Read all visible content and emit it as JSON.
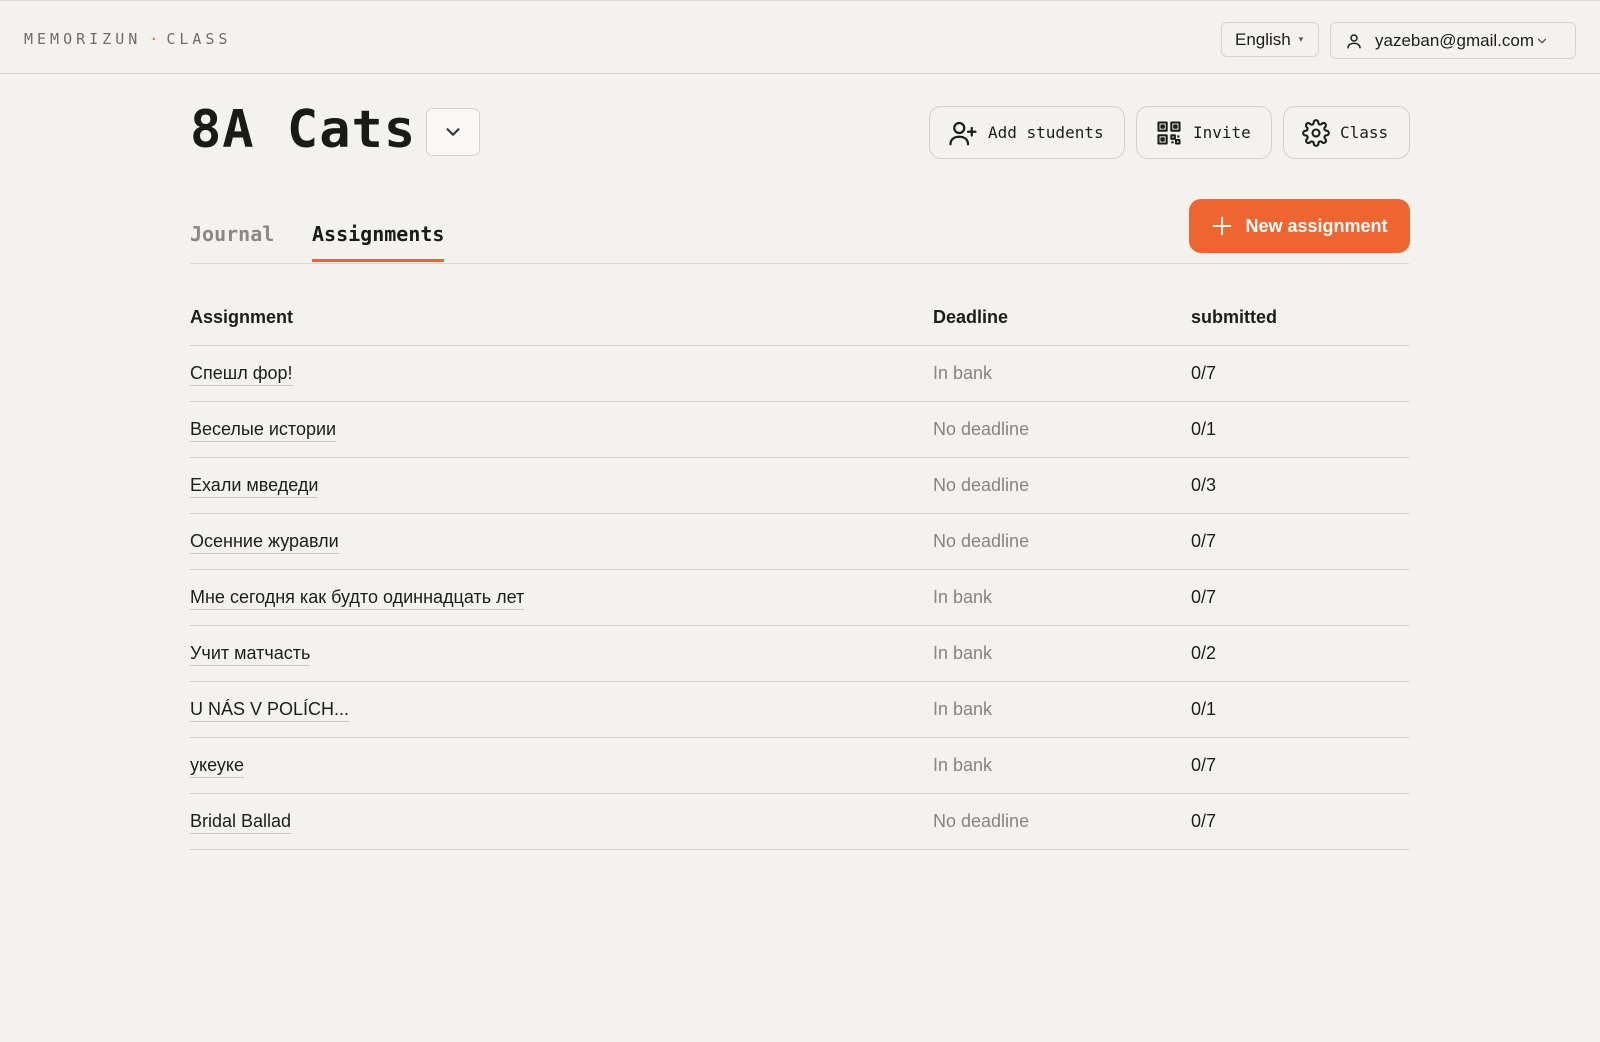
{
  "header": {
    "logo_main": "MEMORIZUN",
    "logo_dot": "·",
    "logo_sub": "CLASS",
    "language": "English",
    "user_email": "yazeban@gmail.com"
  },
  "class": {
    "title": "8A Cats",
    "actions": {
      "add_students": "Add students",
      "invite": "Invite",
      "class_settings": "Class"
    }
  },
  "tabs": [
    {
      "label": "Journal",
      "active": false
    },
    {
      "label": "Assignments",
      "active": true
    }
  ],
  "new_assignment_label": "New assignment",
  "table": {
    "headers": [
      "Assignment",
      "Deadline",
      "submitted"
    ],
    "rows": [
      {
        "name": "Спешл фор!",
        "deadline": "In bank",
        "submitted": "0/7"
      },
      {
        "name": "Веселые истории",
        "deadline": "No deadline",
        "submitted": "0/1"
      },
      {
        "name": "Ехали мведеди",
        "deadline": "No deadline",
        "submitted": "0/3"
      },
      {
        "name": "Осенние журавли",
        "deadline": "No deadline",
        "submitted": "0/7"
      },
      {
        "name": "Мне сегодня как будто одиннадцать лет",
        "deadline": "In bank",
        "submitted": "0/7"
      },
      {
        "name": "Учит матчасть",
        "deadline": "In bank",
        "submitted": "0/2"
      },
      {
        "name": "U NÁS V POLÍCH...",
        "deadline": "In bank",
        "submitted": "0/1"
      },
      {
        "name": "укеуке",
        "deadline": "In bank",
        "submitted": "0/7"
      },
      {
        "name": "Bridal Ballad",
        "deadline": "No deadline",
        "submitted": "0/7"
      }
    ]
  },
  "colors": {
    "accent": "#ef6532",
    "background": "#f4f2ee",
    "muted_text": "#86847f"
  },
  "icons": {
    "user": "user-icon",
    "chevron": "chevron-down-icon",
    "add_user": "user-plus-icon",
    "qr": "qr-code-icon",
    "gear": "gear-icon",
    "plus": "plus-icon"
  }
}
